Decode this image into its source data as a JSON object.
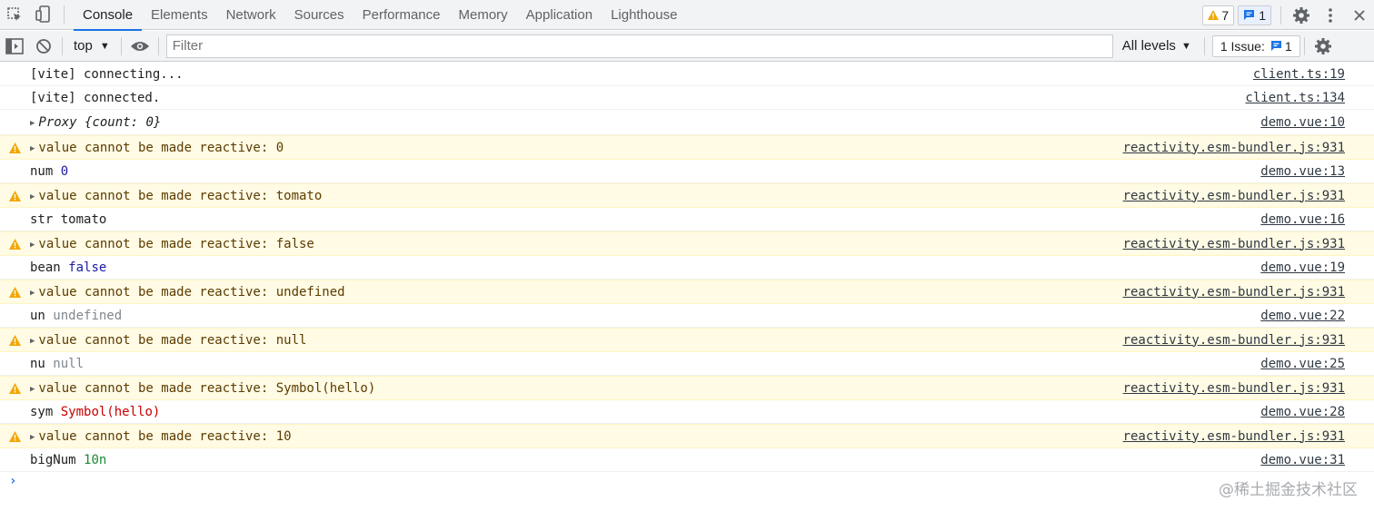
{
  "tabs": [
    "Console",
    "Elements",
    "Network",
    "Sources",
    "Performance",
    "Memory",
    "Application",
    "Lighthouse"
  ],
  "active_tab": "Console",
  "warnings_count": "7",
  "messages_count": "1",
  "toolbar": {
    "context": "top",
    "filter_placeholder": "Filter",
    "levels": "All levels",
    "issues_label": "1 Issue:",
    "issues_count": "1"
  },
  "colors": {
    "accent": "#1a73e8",
    "warning_bg": "#fffbe5",
    "warning_icon": "#f2a600"
  },
  "log": [
    {
      "type": "log",
      "text": "[vite] connecting...",
      "source": "client.ts:19"
    },
    {
      "type": "log",
      "text": "[vite] connected.",
      "source": "client.ts:134"
    },
    {
      "type": "obj",
      "label": "Proxy",
      "value": "{count: 0}",
      "source": "demo.vue:10"
    },
    {
      "type": "warn",
      "text": "value cannot be made reactive: 0",
      "source": "reactivity.esm-bundler.js:931"
    },
    {
      "type": "kv",
      "key": "num",
      "value": "0",
      "cls": "v-num",
      "source": "demo.vue:13"
    },
    {
      "type": "warn",
      "text": "value cannot be made reactive: tomato",
      "source": "reactivity.esm-bundler.js:931"
    },
    {
      "type": "kv",
      "key": "str",
      "value": "tomato",
      "cls": "",
      "source": "demo.vue:16"
    },
    {
      "type": "warn",
      "text": "value cannot be made reactive: false",
      "source": "reactivity.esm-bundler.js:931"
    },
    {
      "type": "kv",
      "key": "bean",
      "value": "false",
      "cls": "v-bool",
      "source": "demo.vue:19"
    },
    {
      "type": "warn",
      "text": "value cannot be made reactive: undefined",
      "source": "reactivity.esm-bundler.js:931"
    },
    {
      "type": "kv",
      "key": "un",
      "value": "undefined",
      "cls": "v-undef",
      "source": "demo.vue:22"
    },
    {
      "type": "warn",
      "text": "value cannot be made reactive: null",
      "source": "reactivity.esm-bundler.js:931"
    },
    {
      "type": "kv",
      "key": "nu",
      "value": "null",
      "cls": "v-undef",
      "source": "demo.vue:25"
    },
    {
      "type": "warn",
      "text": "value cannot be made reactive: Symbol(hello)",
      "source": "reactivity.esm-bundler.js:931"
    },
    {
      "type": "kv",
      "key": "sym",
      "value": "Symbol(hello)",
      "cls": "v-sym",
      "source": "demo.vue:28"
    },
    {
      "type": "warn",
      "text": "value cannot be made reactive: 10",
      "source": "reactivity.esm-bundler.js:931"
    },
    {
      "type": "kv",
      "key": "bigNum",
      "value": "10n",
      "cls": "v-big",
      "source": "demo.vue:31"
    }
  ],
  "watermark": "@稀土掘金技术社区"
}
